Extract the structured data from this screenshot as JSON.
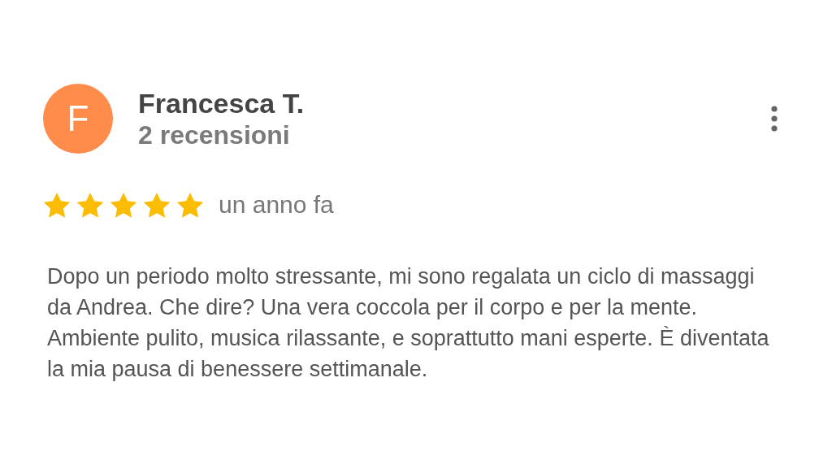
{
  "review": {
    "avatar_letter": "F",
    "author": "Francesca T.",
    "review_count": "2 recensioni",
    "stars": 5,
    "time": "un anno fa",
    "text": "Dopo un periodo molto stressante, mi sono regalata un ciclo di massaggi da Andrea. Che dire? Una vera coccola per il corpo e per la mente. Ambiente pulito, musica rilassante, e soprattutto mani esperte. È diventata la mia pausa di benessere settimanale."
  }
}
